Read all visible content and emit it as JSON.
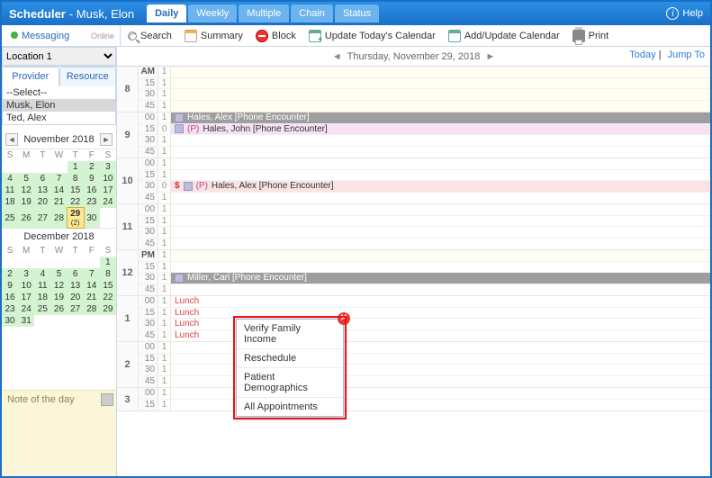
{
  "header": {
    "title": "Scheduler",
    "subtitle": "- Musk, Elon",
    "tabs": [
      "Daily",
      "Weekly",
      "Multiple",
      "Chain",
      "Status"
    ],
    "active_tab": "Daily",
    "help": "Help"
  },
  "left_toolbar": {
    "messaging": "Messaging",
    "status": "Online"
  },
  "toolbar": {
    "search": "Search",
    "summary": "Summary",
    "block": "Block",
    "update_today": "Update Today's Calendar",
    "add_update": "Add/Update Calendar",
    "print": "Print"
  },
  "datebar": {
    "location": "Location 1",
    "date": "Thursday, November 29, 2018",
    "today": "Today",
    "jumpto": "Jump To"
  },
  "sidebar": {
    "tabs": {
      "provider": "Provider",
      "resource": "Resource",
      "active": "Provider"
    },
    "providers": [
      "--Select--",
      "Musk, Elon",
      "Ted, Alex"
    ],
    "selected_provider": "Musk, Elon",
    "cal1": {
      "label": "November 2018",
      "dow": [
        "S",
        "M",
        "T",
        "W",
        "T",
        "F",
        "S"
      ],
      "rows": [
        [
          "",
          "",
          "",
          "",
          "1",
          "2",
          "3"
        ],
        [
          "4",
          "5",
          "6",
          "7",
          "8",
          "9",
          "10"
        ],
        [
          "11",
          "12",
          "13",
          "14",
          "15",
          "16",
          "17"
        ],
        [
          "18",
          "19",
          "20",
          "21",
          "22",
          "23",
          "24"
        ],
        [
          "25",
          "26",
          "27",
          "28",
          "29",
          "30",
          ""
        ]
      ],
      "today": "29",
      "today_sub": "(2)"
    },
    "cal2": {
      "label": "December 2018",
      "dow": [
        "S",
        "M",
        "T",
        "W",
        "T",
        "F",
        "S"
      ],
      "rows": [
        [
          "",
          "",
          "",
          "",
          "",
          "",
          "1"
        ],
        [
          "2",
          "3",
          "4",
          "5",
          "6",
          "7",
          "8"
        ],
        [
          "9",
          "10",
          "11",
          "12",
          "13",
          "14",
          "15"
        ],
        [
          "16",
          "17",
          "18",
          "19",
          "20",
          "21",
          "22"
        ],
        [
          "23",
          "24",
          "25",
          "26",
          "27",
          "28",
          "29"
        ],
        [
          "30",
          "31",
          "",
          "",
          "",
          "",
          ""
        ]
      ]
    },
    "note_label": "Note of the day"
  },
  "grid": {
    "am": "AM",
    "pm": "PM",
    "minutes": [
      "00",
      "15",
      "30",
      "45"
    ],
    "hours": [
      {
        "h": "8",
        "off": true,
        "am": true,
        "slots": [
          {
            "m": "AM",
            "c": "1"
          },
          {
            "m": "15",
            "c": "1"
          },
          {
            "m": "30",
            "c": "1"
          },
          {
            "m": "45",
            "c": "1"
          }
        ]
      },
      {
        "h": "9",
        "slots": [
          {
            "m": "00",
            "c": "1",
            "cls": "appt-gray",
            "chip": true,
            "text": "Hales, Alex [Phone Encounter]"
          },
          {
            "m": "15",
            "c": "0",
            "cls": "appt-pink",
            "chip": true,
            "p": "(P)",
            "text": "Hales, John [Phone Encounter]"
          },
          {
            "m": "30",
            "c": "1"
          },
          {
            "m": "45",
            "c": "1"
          }
        ]
      },
      {
        "h": "10",
        "slots": [
          {
            "m": "00",
            "c": "1"
          },
          {
            "m": "15",
            "c": "1"
          },
          {
            "m": "30",
            "c": "0",
            "cls": "appt-red",
            "dollar": "$",
            "chip": true,
            "p": "(P)",
            "text": "Hales, Alex [Phone Encounter]"
          },
          {
            "m": "45",
            "c": "1"
          }
        ]
      },
      {
        "h": "11",
        "slots": [
          {
            "m": "00",
            "c": "1"
          },
          {
            "m": "15",
            "c": "1"
          },
          {
            "m": "30",
            "c": "1"
          },
          {
            "m": "45",
            "c": "1"
          }
        ]
      },
      {
        "h": "12",
        "off_first": true,
        "slots": [
          {
            "m": "PM",
            "c": "1",
            "off": true
          },
          {
            "m": "15",
            "c": "1"
          },
          {
            "m": "30",
            "c": "1",
            "cls": "appt-gray",
            "chip": true,
            "text": "Miller, Carl [Phone Encounter]"
          },
          {
            "m": "45",
            "c": "1"
          }
        ]
      },
      {
        "h": "1",
        "slots": [
          {
            "m": "00",
            "c": "1",
            "lunch": "Lunch"
          },
          {
            "m": "15",
            "c": "1",
            "lunch": "Lunch"
          },
          {
            "m": "30",
            "c": "1",
            "lunch": "Lunch"
          },
          {
            "m": "45",
            "c": "1",
            "lunch": "Lunch"
          }
        ]
      },
      {
        "h": "2",
        "slots": [
          {
            "m": "00",
            "c": "1"
          },
          {
            "m": "15",
            "c": "1"
          },
          {
            "m": "30",
            "c": "1"
          },
          {
            "m": "45",
            "c": "1"
          }
        ]
      },
      {
        "h": "3",
        "slots": [
          {
            "m": "00",
            "c": "1"
          },
          {
            "m": "15",
            "c": "1"
          }
        ]
      }
    ]
  },
  "context_menu": {
    "items": [
      "Verify Family Income",
      "Reschedule",
      "Patient Demographics",
      "All Appointments"
    ]
  }
}
